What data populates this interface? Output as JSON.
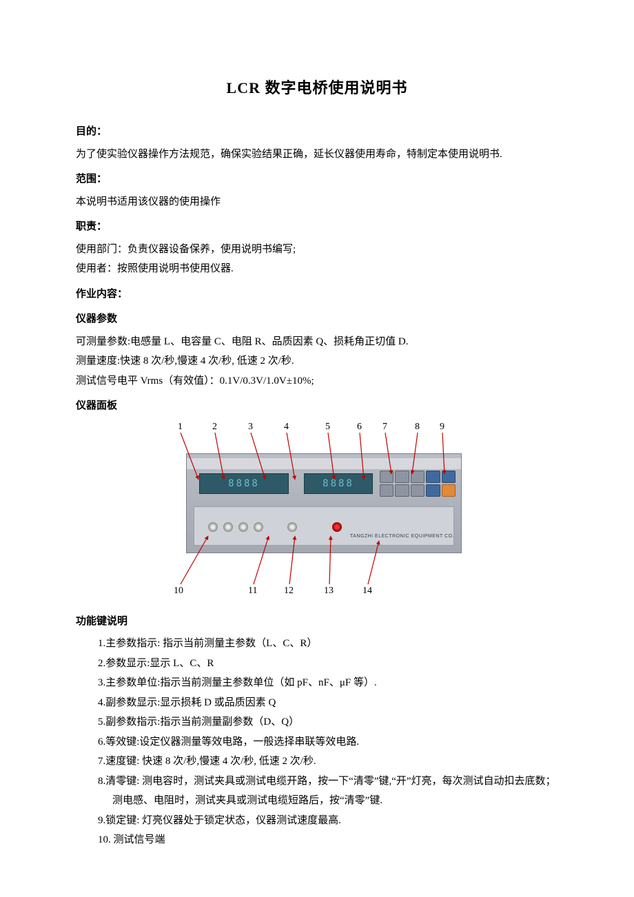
{
  "title": "LCR 数字电桥使用说明书",
  "sections": {
    "s0": {
      "head": "目的：",
      "p0": "为了使实验仪器操作方法规范，确保实验结果正确，延长仪器使用寿命，特制定本使用说明书."
    },
    "s1": {
      "head": "范围：",
      "p0": "本说明书适用该仪器的使用操作"
    },
    "s2": {
      "head": "职责：",
      "p0": "使用部门：负责仪器设备保养，使用说明书编写;",
      "p1": "使用者：按照使用说明书使用仪器."
    },
    "s3": {
      "head": "作业内容："
    },
    "s4": {
      "head": "仪器参数",
      "p0": "可测量参数:电感量 L、电容量 C、电阻 R、品质因素 Q、损耗角正切值 D.",
      "p1": "测量速度:快速 8 次/秒,慢速 4 次/秒, 低速 2 次/秒.",
      "p2": "测试信号电平 Vrms（有效值）：0.1V/0.3V/1.0V±10%;"
    },
    "s5": {
      "head": "仪器面板"
    },
    "s6": {
      "head": "功能键说明"
    }
  },
  "callouts": {
    "top": {
      "c1": "1",
      "c2": "2",
      "c3": "3",
      "c4": "4",
      "c5": "5",
      "c6": "6",
      "c7": "7",
      "c8": "8",
      "c9": "9"
    },
    "bottom": {
      "c10": "10",
      "c11": "11",
      "c12": "12",
      "c13": "13",
      "c14": "14"
    }
  },
  "device": {
    "lcd1": "8888",
    "lcd2": "8888",
    "brand": "TANGZHI ELECTRONIC EQUIPMENT CO."
  },
  "func_keys": {
    "k1": "1.主参数指示: 指示当前测量主参数（L、C、R）",
    "k2": "2.参数显示:显示 L、C、R",
    "k3": "3.主参数单位:指示当前测量主参数单位（如 pF、nF、μF 等）.",
    "k4": "4.副参数显示:显示损耗 D 或品质因素 Q",
    "k5": "5.副参数指示:指示当前测量副参数（D、Q）",
    "k6": "6.等效键:设定仪器测量等效电路，一般选择串联等效电路.",
    "k7": "7.速度键: 快速 8 次/秒,慢速 4 次/秒, 低速 2 次/秒.",
    "k8": "8.清零键: 测电容时，测试夹具或测试电缆开路，按一下“清零”键,“开”灯亮，每次测试自动扣去底数；测电感、电阻时，测试夹具或测试电缆短路后，按“清零”键.",
    "k9": "9.锁定键: 灯亮仪器处于锁定状态，仪器测试速度最高.",
    "k10": "10. 测试信号端"
  }
}
